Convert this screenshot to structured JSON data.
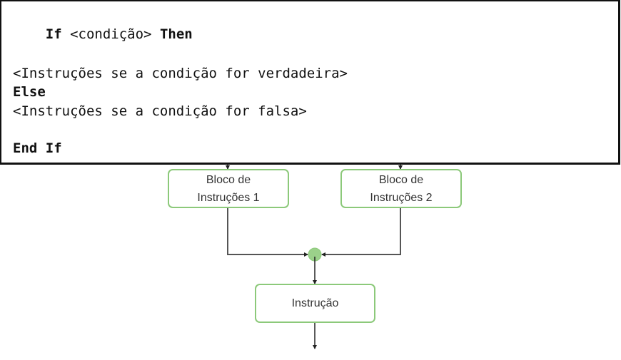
{
  "code": {
    "lines": [
      {
        "parts": [
          {
            "text": "If",
            "bold": true
          },
          {
            "text": " <condição> ",
            "bold": false
          },
          {
            "text": "Then",
            "bold": true
          }
        ]
      },
      {
        "parts": []
      },
      {
        "parts": []
      },
      {
        "parts": [
          {
            "text": "<Instruções se a condição for verdadeira>",
            "bold": false
          }
        ]
      },
      {
        "parts": [
          {
            "text": "Else",
            "bold": true
          }
        ]
      },
      {
        "parts": [
          {
            "text": "<Instruções se a condição for falsa>",
            "bold": false
          }
        ]
      },
      {
        "parts": []
      },
      {
        "parts": [
          {
            "text": "End If",
            "bold": true
          }
        ]
      }
    ],
    "line1": {
      "kw1": "If",
      "cond": " <condição> ",
      "kw2": "Then"
    },
    "line_true": "<Instruções se a condição for verdadeira>",
    "line_else": "Else",
    "line_false": "<Instruções se a condição for falsa>",
    "line_end": "End If"
  },
  "flowchart": {
    "colors": {
      "node_border": "#8cc97a",
      "merge_fill": "#9bd18a",
      "line": "#222222"
    },
    "block1": {
      "line1": "Bloco de",
      "line2": "Instruções 1"
    },
    "block2": {
      "line1": "Bloco de",
      "line2": "Instruções 2"
    },
    "next": {
      "label": "Instrução"
    }
  }
}
